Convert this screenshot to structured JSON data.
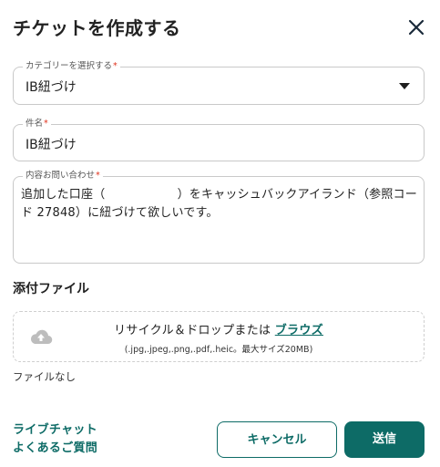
{
  "dialog": {
    "title": "チケットを作成する"
  },
  "category": {
    "label": "カテゴリーを選択する",
    "required_mark": "*",
    "value": "IB紐づけ"
  },
  "subject": {
    "label": "件名",
    "required_mark": "*",
    "value": "IB紐づけ"
  },
  "inquiry": {
    "label": "内容お問い合わせ",
    "required_mark": "*",
    "value": "追加した口座（　　　　　　）をキャッシュバックアイランド（参照コード 27848）に紐づけて欲しいです。"
  },
  "attachment": {
    "title": "添付ファイル",
    "drop_text": "リサイクル＆ドロップまたは",
    "browse_label": "ブラウズ",
    "formats_text": "(.jpg,.jpeg,.png,.pdf,.heic。最大サイズ20MB)",
    "status": "ファイルなし"
  },
  "footer": {
    "live_chat_label": "ライブチャット",
    "faq_label": "よくあるご質問",
    "cancel_label": "キャンセル",
    "submit_label": "送信"
  },
  "colors": {
    "accent": "#0d6b66",
    "required": "#e0321c",
    "border": "#c9c9c9"
  },
  "icons": {
    "close": "close-icon",
    "dropdown": "caret-down-icon",
    "upload": "cloud-upload-icon"
  }
}
